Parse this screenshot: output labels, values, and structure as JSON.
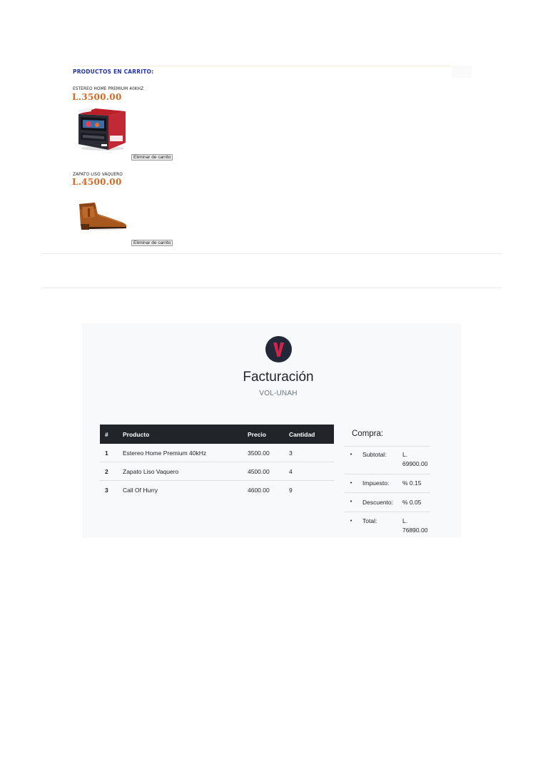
{
  "cart": {
    "heading": "PRODUCTOS EN CARRITO:",
    "items": [
      {
        "name": "ESTEREO HOME PREMIUM 40KHZ",
        "price": "L.3500.00",
        "remove_label": "Eliminar de carrito",
        "image_icon": "car-stereo-image"
      },
      {
        "name": "ZAPATO LISO VAQUERO",
        "price": "L.4500.00",
        "remove_label": "Eliminar de carrito",
        "image_icon": "cowboy-boot-image"
      }
    ]
  },
  "invoice": {
    "logo_letter": "V",
    "title": "Facturación",
    "subtitle": "VOL-UNAH",
    "colors": {
      "logo_bg": "#232838",
      "logo_accent": "#d6224a",
      "table_header": "#212529",
      "card_bg": "#f8f9fa"
    },
    "table": {
      "headers": [
        "#",
        "Producto",
        "Precio",
        "Cantidad"
      ],
      "rows": [
        [
          "1",
          "Estereo Home Premium 40kHz",
          "3500.00",
          "3"
        ],
        [
          "2",
          "Zapato Liso Vaquero",
          "4500.00",
          "4"
        ],
        [
          "3",
          "Call Of Hurry",
          "4600.00",
          "9"
        ]
      ]
    },
    "summary": {
      "title": "Compra:",
      "rows": [
        {
          "label": "Subtotal:",
          "value": "L. 69900.00"
        },
        {
          "label": "Impuesto:",
          "value": "% 0.15"
        },
        {
          "label": "Descuento:",
          "value": "% 0.05"
        },
        {
          "label": "Total:",
          "value": "L. 76890.00"
        }
      ]
    }
  }
}
